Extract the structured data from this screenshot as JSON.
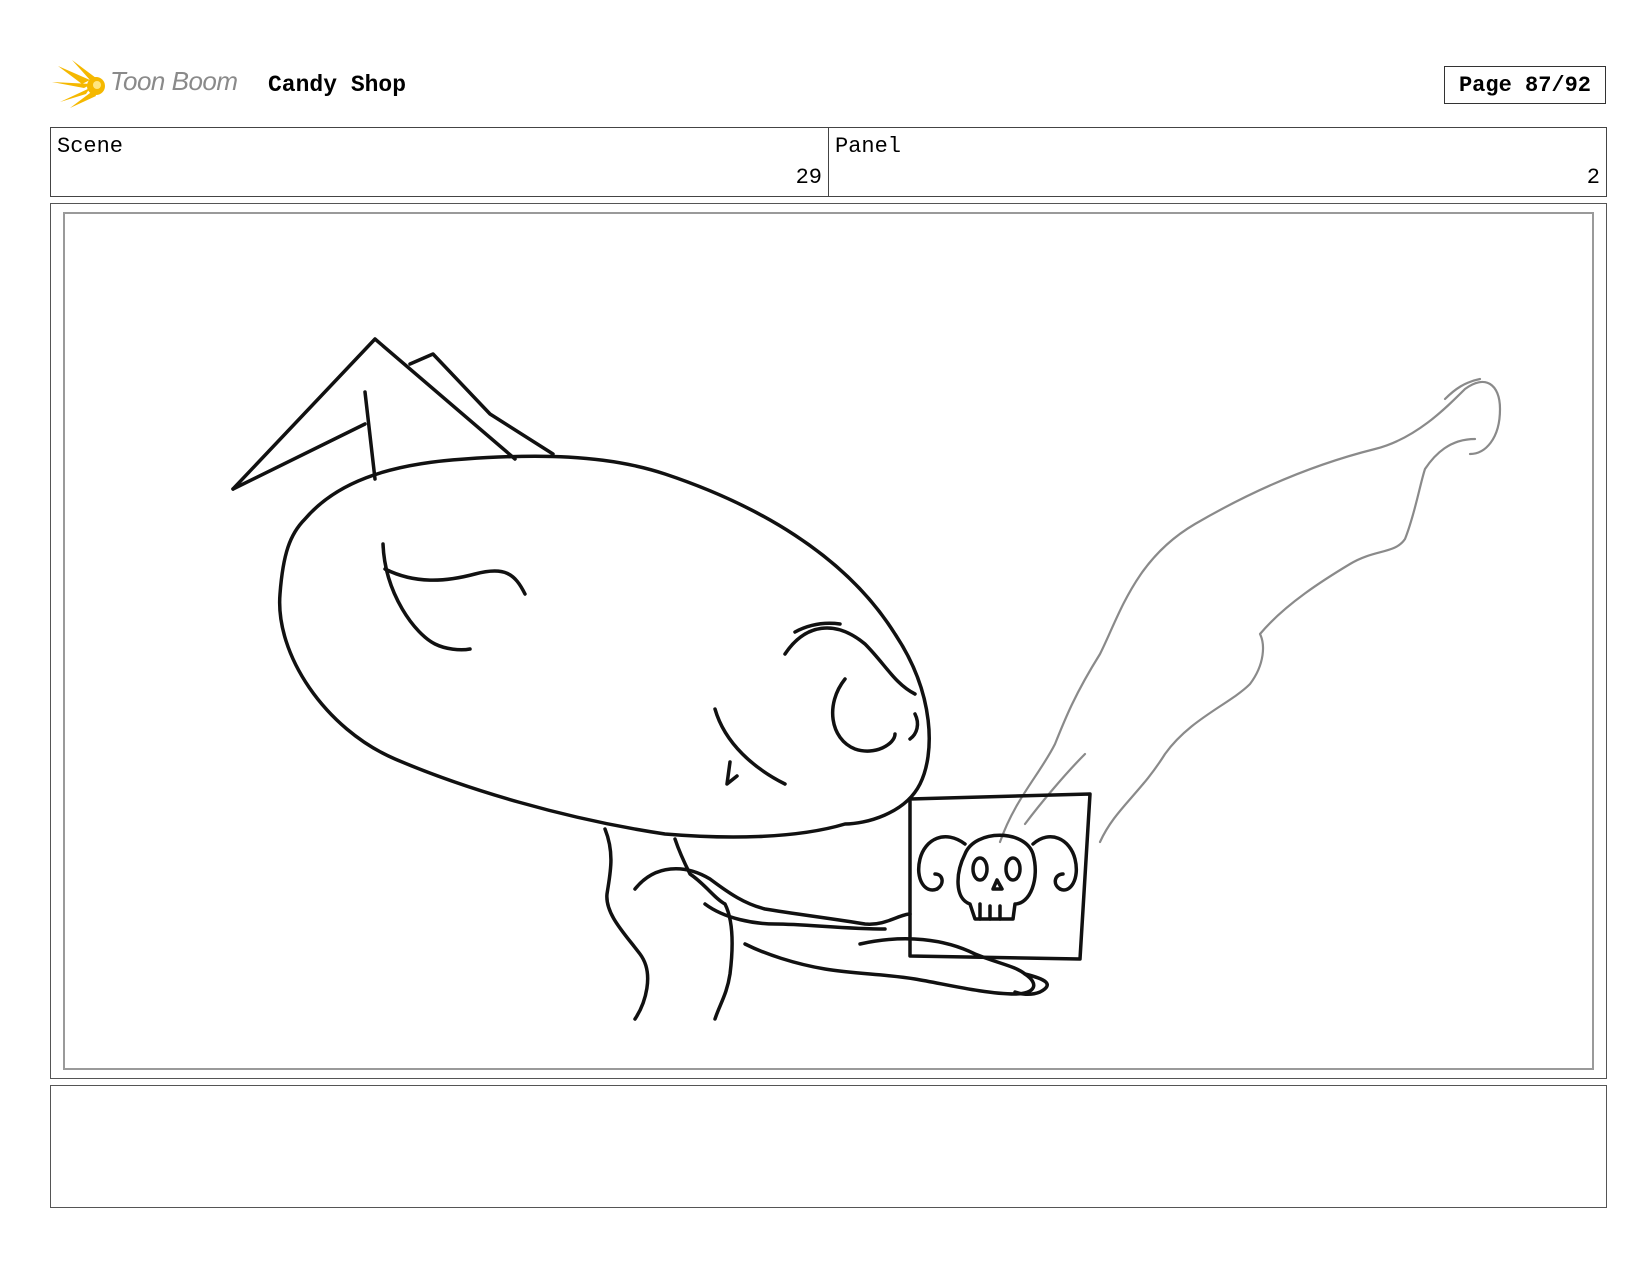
{
  "header": {
    "logo_text": "Toon Boom",
    "project_title": "Candy Shop",
    "page_label": "Page 87/92"
  },
  "info": {
    "scene_label": "Scene",
    "scene_value": "29",
    "panel_label": "Panel",
    "panel_value": "2"
  },
  "panel": {
    "drawing_icon": "character-holding-skull-mug-sketch"
  },
  "notes": {
    "text": ""
  },
  "colors": {
    "logo_accent": "#f5b800",
    "frame_border": "#555555",
    "inner_border": "#9a9a9a",
    "steam_stroke": "#8a8a8a"
  }
}
